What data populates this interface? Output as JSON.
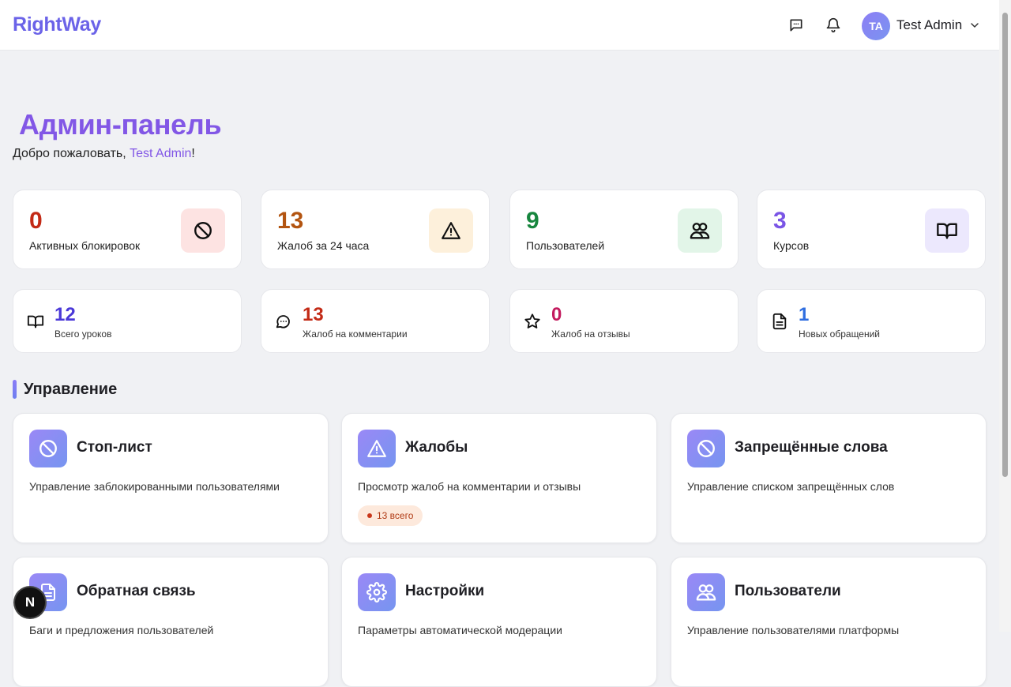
{
  "header": {
    "logo": "RightWay",
    "user": {
      "initials": "TA",
      "name": "Test Admin"
    }
  },
  "page": {
    "title": "Админ-панель",
    "welcome_prefix": "Добро пожаловать, ",
    "welcome_name": "Test Admin",
    "welcome_suffix": "!"
  },
  "stats": [
    {
      "value": "0",
      "label": "Активных блокировок",
      "color": "#c32a16",
      "icon_bg": "#fde3e2",
      "icon": "ban-icon"
    },
    {
      "value": "13",
      "label": "Жалоб за 24 часа",
      "color": "#b35410",
      "icon_bg": "#fdf0db",
      "icon": "warning-icon"
    },
    {
      "value": "9",
      "label": "Пользователей",
      "color": "#17863e",
      "icon_bg": "#e2f5e8",
      "icon": "users-icon"
    },
    {
      "value": "3",
      "label": "Курсов",
      "color": "#7a55e6",
      "icon_bg": "#ece8fd",
      "icon": "book-icon"
    }
  ],
  "mini_stats": [
    {
      "value": "12",
      "label": "Всего уроков",
      "color": "#4a38d8",
      "icon": "book-icon"
    },
    {
      "value": "13",
      "label": "Жалоб на комментарии",
      "color": "#c32a16",
      "icon": "comment-icon"
    },
    {
      "value": "0",
      "label": "Жалоб на отзывы",
      "color": "#c31a5e",
      "icon": "star-icon"
    },
    {
      "value": "1",
      "label": "Новых обращений",
      "color": "#2f6ee0",
      "icon": "file-icon"
    }
  ],
  "section": {
    "title": "Управление"
  },
  "manage": [
    {
      "title": "Стоп-лист",
      "desc": "Управление заблокированными пользователями",
      "icon": "ban-icon"
    },
    {
      "title": "Жалобы",
      "desc": "Просмотр жалоб на комментарии и отзывы",
      "badge": "13 всего",
      "icon": "warning-icon"
    },
    {
      "title": "Запрещённые слова",
      "desc": "Управление списком запрещённых слов",
      "icon": "ban-icon"
    },
    {
      "title": "Обратная связь",
      "desc": "Баги и предложения пользователей",
      "icon": "file-icon"
    },
    {
      "title": "Настройки",
      "desc": "Параметры автоматической модерации",
      "icon": "gear-icon"
    },
    {
      "title": "Пользователи",
      "desc": "Управление пользователями платформы",
      "icon": "users-icon"
    }
  ],
  "dev_badge": {
    "label": "N"
  }
}
